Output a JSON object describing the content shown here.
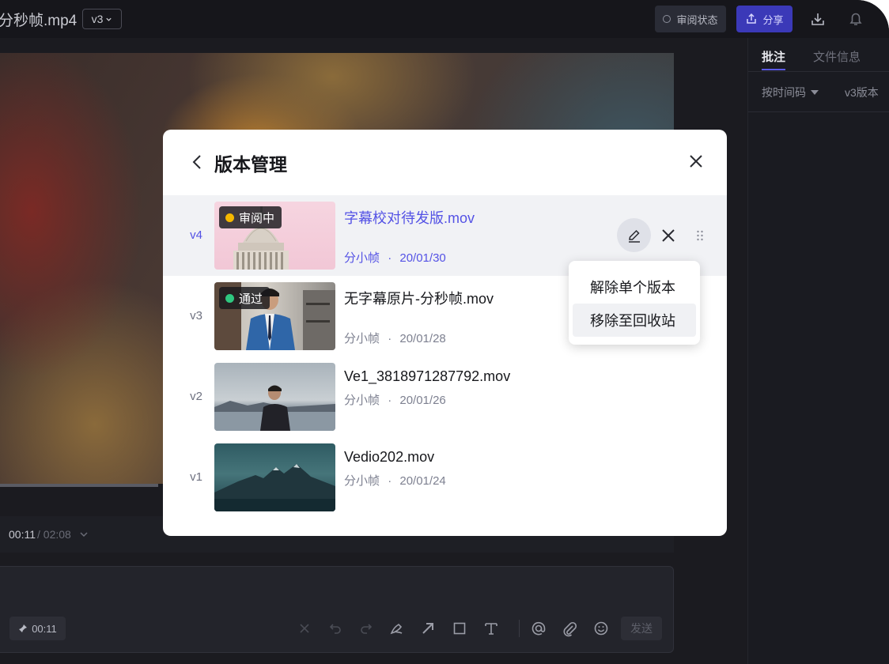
{
  "header": {
    "file_title": "分秒帧.mp4",
    "version": "v3",
    "review_status_label": "审阅状态",
    "share_label": "分享",
    "icons": [
      "chevron-down-icon",
      "share-icon",
      "download-icon",
      "notification-icon"
    ]
  },
  "player": {
    "current_time": "00:11",
    "total_time": "/ 02:08"
  },
  "comment_box": {
    "timecode": "00:11",
    "send_label": "发送",
    "tools": [
      "close-icon",
      "undo-icon",
      "redo-icon",
      "pen-icon",
      "arrow-icon",
      "rectangle-icon",
      "text-icon",
      "mention-icon",
      "attachment-icon",
      "emoji-icon"
    ]
  },
  "right_panel": {
    "tabs": [
      {
        "label": "批注",
        "active": true
      },
      {
        "label": "文件信息",
        "active": false
      }
    ],
    "filters": [
      "按时间码",
      "v3版本"
    ]
  },
  "modal": {
    "title": "版本管理",
    "versions": [
      {
        "label": "v4",
        "name": "字幕校对待发版.mov",
        "author": "分小帧",
        "date": "20/01/30",
        "badge": "审阅中",
        "badge_color": "#f5b800",
        "selected": true
      },
      {
        "label": "v3",
        "name": "无字幕原片-分秒帧.mov",
        "author": "分小帧",
        "date": "20/01/28",
        "badge": "通过",
        "badge_color": "#2fc780",
        "selected": false
      },
      {
        "label": "v2",
        "name": "Ve1_3818971287792.mov",
        "author": "分小帧",
        "date": "20/01/26",
        "badge": "",
        "selected": false
      },
      {
        "label": "v1",
        "name": "Vedio202.mov",
        "author": "分小帧",
        "date": "20/01/24",
        "badge": "",
        "selected": false
      }
    ],
    "meta_separator": "·"
  },
  "context_menu": {
    "items": [
      "解除单个版本",
      "移除至回收站"
    ],
    "hovered_index": 1
  },
  "colors": {
    "accent": "#5452e5",
    "review_yellow": "#f5b800",
    "approved_green": "#2fc780",
    "dark_bg": "#1b1b20"
  }
}
